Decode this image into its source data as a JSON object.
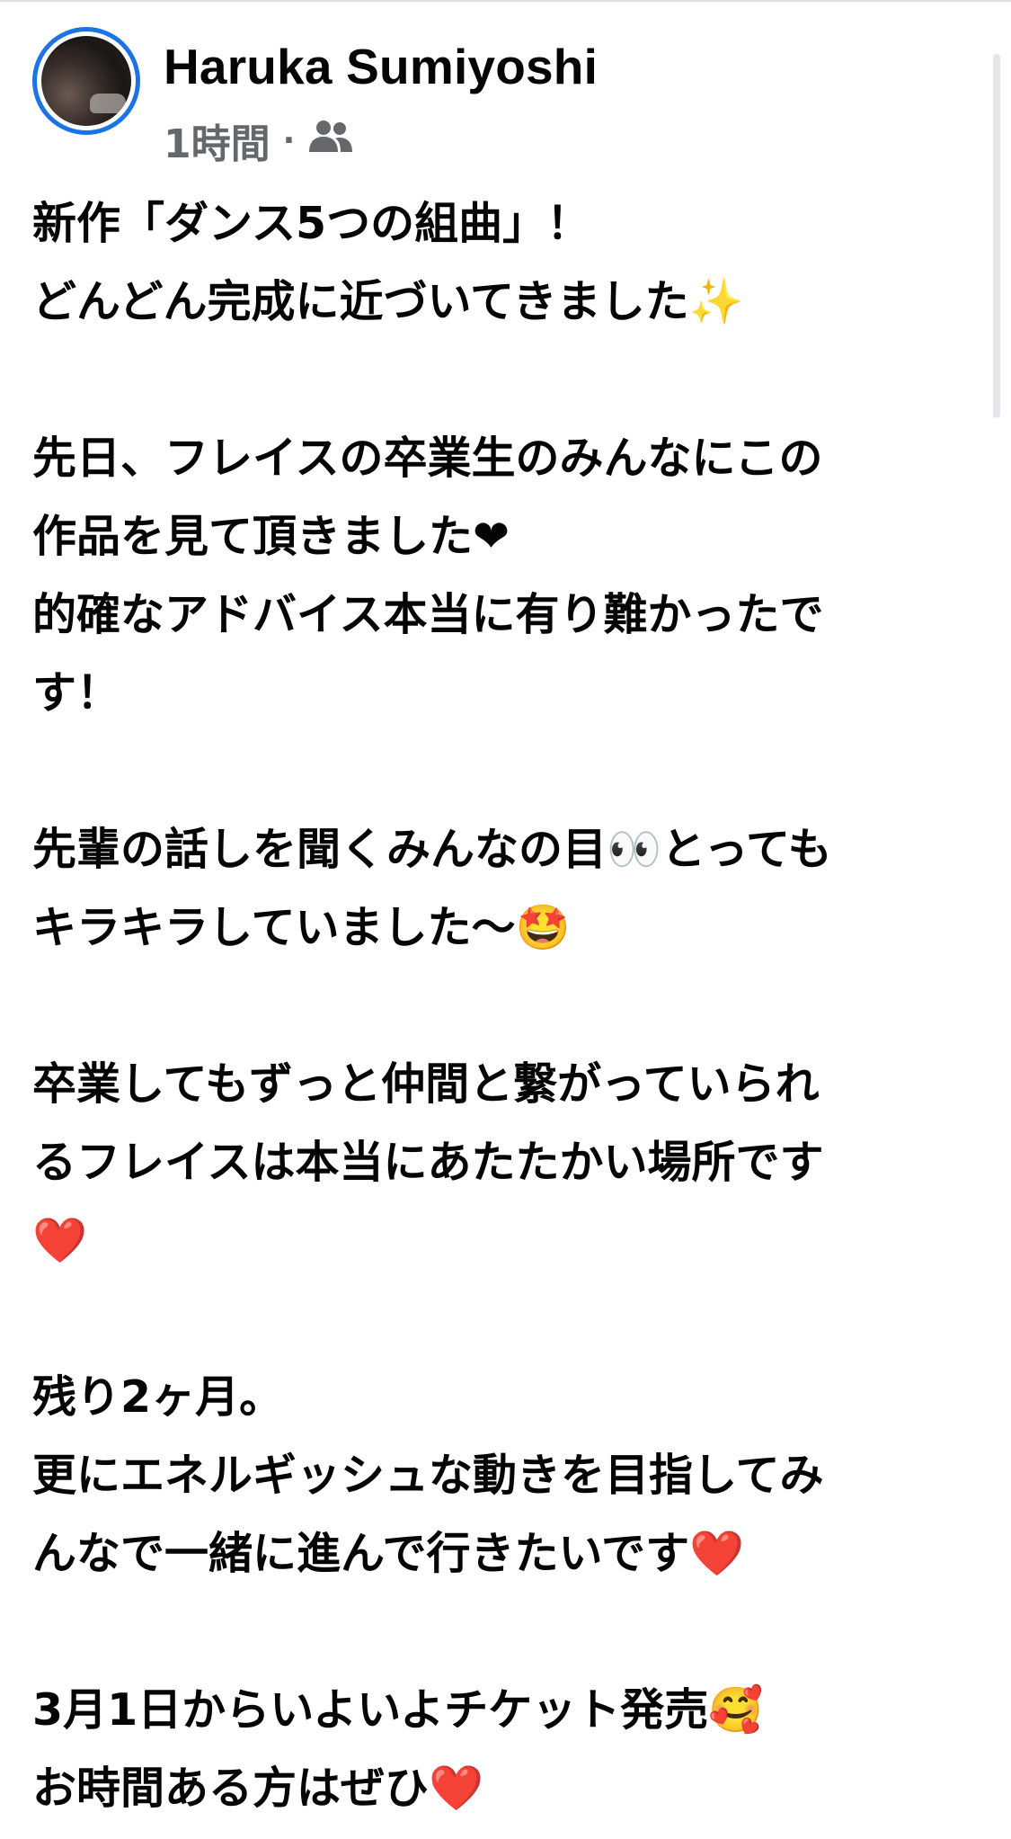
{
  "post": {
    "author": "Haruka Sumiyoshi",
    "time": "1時間",
    "separator": "·",
    "audience_icon": "friends-icon",
    "lines": [
      "新作「ダンス5つの組曲」！",
      "どんどん完成に近づいてきました✨",
      "",
      "先日、フレイスの卒業生のみんなにこの",
      "作品を見て頂きました❤",
      "的確なアドバイス本当に有り難かったで",
      "す！",
      "",
      "先輩の話しを聞くみんなの目👀とっても",
      "キラキラしていました〜🤩",
      "",
      "卒業してもずっと仲間と繋がっていられ",
      "るフレイスは本当にあたたかい場所です",
      "❤️",
      "",
      "残り2ヶ月。",
      "更にエネルギッシュな動きを目指してみ",
      "んなで一緒に進んで行きたいです❤️",
      "",
      "3月1日からいよいよチケット発売🥰",
      "お時間ある方はぜひ❤️"
    ]
  },
  "colors": {
    "avatar_ring": "#1b74e4",
    "meta_gray": "#65676b",
    "text": "#050505"
  }
}
